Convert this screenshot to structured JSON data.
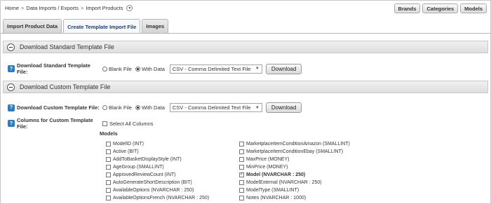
{
  "breadcrumb": {
    "items": [
      "Home",
      "Data Imports / Exports",
      "Import Products"
    ],
    "separator": ">"
  },
  "top_buttons": [
    "Brands",
    "Categories",
    "Models"
  ],
  "tabs": [
    {
      "label": "Import Product Data",
      "active": false
    },
    {
      "label": "Create Template Import File",
      "active": true
    },
    {
      "label": "Images",
      "active": false
    }
  ],
  "standard_section": {
    "title": "Download Standard Template File",
    "row_label": "Download Standard Template File:",
    "blank_label": "Blank File",
    "with_data_label": "With Data",
    "selected": "With Data",
    "format_value": "CSV - Comma Delimited Text File",
    "download_label": "Download"
  },
  "custom_section": {
    "title": "Download Custom Template File",
    "row_label": "Download Custom Template File:",
    "blank_label": "Blank File",
    "with_data_label": "With Data",
    "selected": "With Data",
    "format_value": "CSV - Comma Delimited Text File",
    "download_label": "Download",
    "columns_label": "Columns for Custom Template File:",
    "select_all_label": "Select All Columns",
    "select_all_checked": false
  },
  "models": {
    "title": "Models",
    "left_columns": [
      {
        "label": "ModelID (INT)",
        "checked": false
      },
      {
        "label": "Active (BIT)",
        "checked": false
      },
      {
        "label": "AddToBasketDisplayStyle (INT)",
        "checked": false
      },
      {
        "label": "AgeGroup (SMALLINT)",
        "checked": false
      },
      {
        "label": "ApprovedReviewCount (INT)",
        "checked": false
      },
      {
        "label": "AutoGenerateShortDescription (BIT)",
        "checked": false
      },
      {
        "label": "AvailableOptions (NVARCHAR : 250)",
        "checked": false
      },
      {
        "label": "AvailableOptionsFrench (NVARCHAR : 250)",
        "checked": false
      }
    ],
    "right_columns": [
      {
        "label": "MarketplaceItemConditionAmazon (SMALLINT)",
        "checked": false
      },
      {
        "label": "MarketplaceItemConditionEbay (SMALLINT)",
        "checked": false
      },
      {
        "label": "MaxPrice (MONEY)",
        "checked": false
      },
      {
        "label": "MinPrice (MONEY)",
        "checked": false
      },
      {
        "label": "Model (NVARCHAR : 250)",
        "checked": true,
        "bold": true
      },
      {
        "label": "ModelExternal (NVARCHAR : 250)",
        "checked": false
      },
      {
        "label": "ModelType (SMALLINT)",
        "checked": false
      },
      {
        "label": "Notes (NVARCHAR : 1000)",
        "checked": false
      }
    ]
  }
}
